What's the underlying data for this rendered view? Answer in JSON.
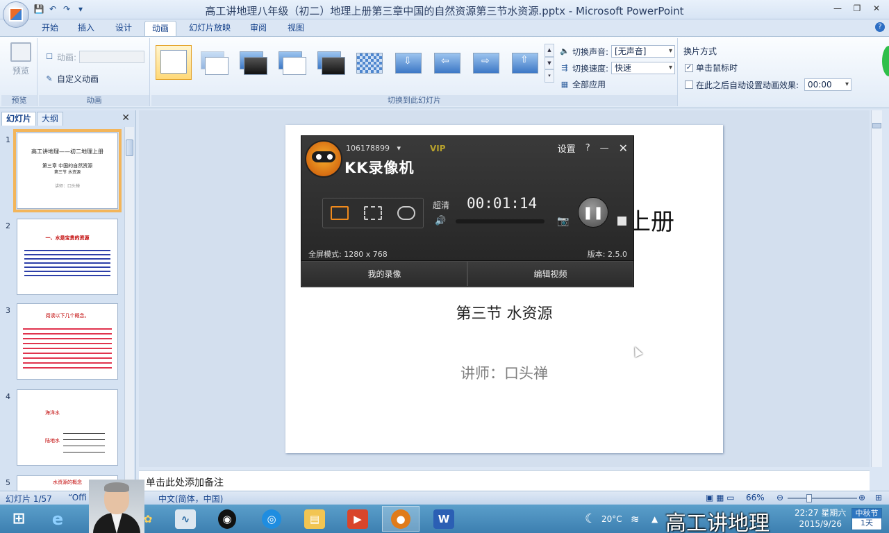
{
  "window": {
    "title": "高工讲地理八年级（初二）地理上册第三章中国的自然资源第三节水资源.pptx - Microsoft PowerPoint",
    "controls": [
      "—",
      "❐",
      "✕"
    ]
  },
  "qat": [
    "💾",
    "↶",
    "↷",
    "▾"
  ],
  "ribbon_tabs": [
    "开始",
    "插入",
    "设计",
    "动画",
    "幻灯片放映",
    "审阅",
    "视图"
  ],
  "active_tab": "动画",
  "ribbon": {
    "preview_group": {
      "button": "预览",
      "label": "预览"
    },
    "animation_group": {
      "animation_label": "动画:",
      "custom_animation": "自定义动画",
      "label": "动画"
    },
    "transition_group": {
      "label": "切换到此幻灯片",
      "sound_label": "切换声音:",
      "sound_value": "[无声音]",
      "speed_label": "切换速度:",
      "speed_value": "快速",
      "apply_all": "全部应用"
    },
    "advance_group": {
      "title": "换片方式",
      "on_click": "单击鼠标时",
      "on_click_checked": true,
      "auto_after": "在此之后自动设置动画效果:",
      "auto_after_checked": false,
      "auto_time": "00:00"
    }
  },
  "left_panel": {
    "tabs": [
      "幻灯片",
      "大纲"
    ],
    "close": "✕",
    "slides": [
      {
        "num": "1",
        "lines": [
          "高工讲地理——初二地理上册",
          "第三章 中国的自然资源",
          "第三节 水资源",
          "讲师：口头禅"
        ]
      },
      {
        "num": "2",
        "lines": [
          "一、水是宝贵的资源"
        ]
      },
      {
        "num": "3",
        "lines": [
          "阅读以下几个概念。"
        ]
      },
      {
        "num": "4",
        "lines": [
          "海洋水",
          "陆地水"
        ]
      },
      {
        "num": "5",
        "lines": [
          "水资源的概念"
        ]
      }
    ]
  },
  "slide": {
    "title_partial": "上册",
    "subtitle": "第三节 水资源",
    "teacher": "讲师：口头禅"
  },
  "notes_placeholder": "单击此处添加备注",
  "statusbar": {
    "slide_count": "幻灯片 1/57",
    "theme": "“Offi",
    "language": "中文(简体，中国)",
    "zoom": "66%"
  },
  "kk_recorder": {
    "user_id": "106178899",
    "vip": "VIP",
    "brand": "KK录像机",
    "settings": "设置",
    "help": "?",
    "minimize": "—",
    "close": "✕",
    "quality": "超清",
    "time": "00:01:14",
    "mode_text": "全屏模式: 1280 x 768",
    "version": "版本: 2.5.0",
    "my_videos": "我的录像",
    "edit_video": "编辑视频"
  },
  "taskbar": {
    "items": [
      "start",
      "ie",
      "",
      "pictures",
      "resource-monitor",
      "qq",
      "browser",
      "explorer",
      "screencast",
      "kk",
      "word"
    ],
    "weather": "20°C",
    "time": "22:27 星期六",
    "date": "2015/9/26",
    "holiday_top": "中秋节",
    "holiday_bottom": "1天",
    "watermark": "高工讲地理"
  },
  "colors": {
    "ribbon_accent": "#15428b",
    "kk_orange": "#f08a1c",
    "taskbar_blue": "#3c7fb0"
  }
}
